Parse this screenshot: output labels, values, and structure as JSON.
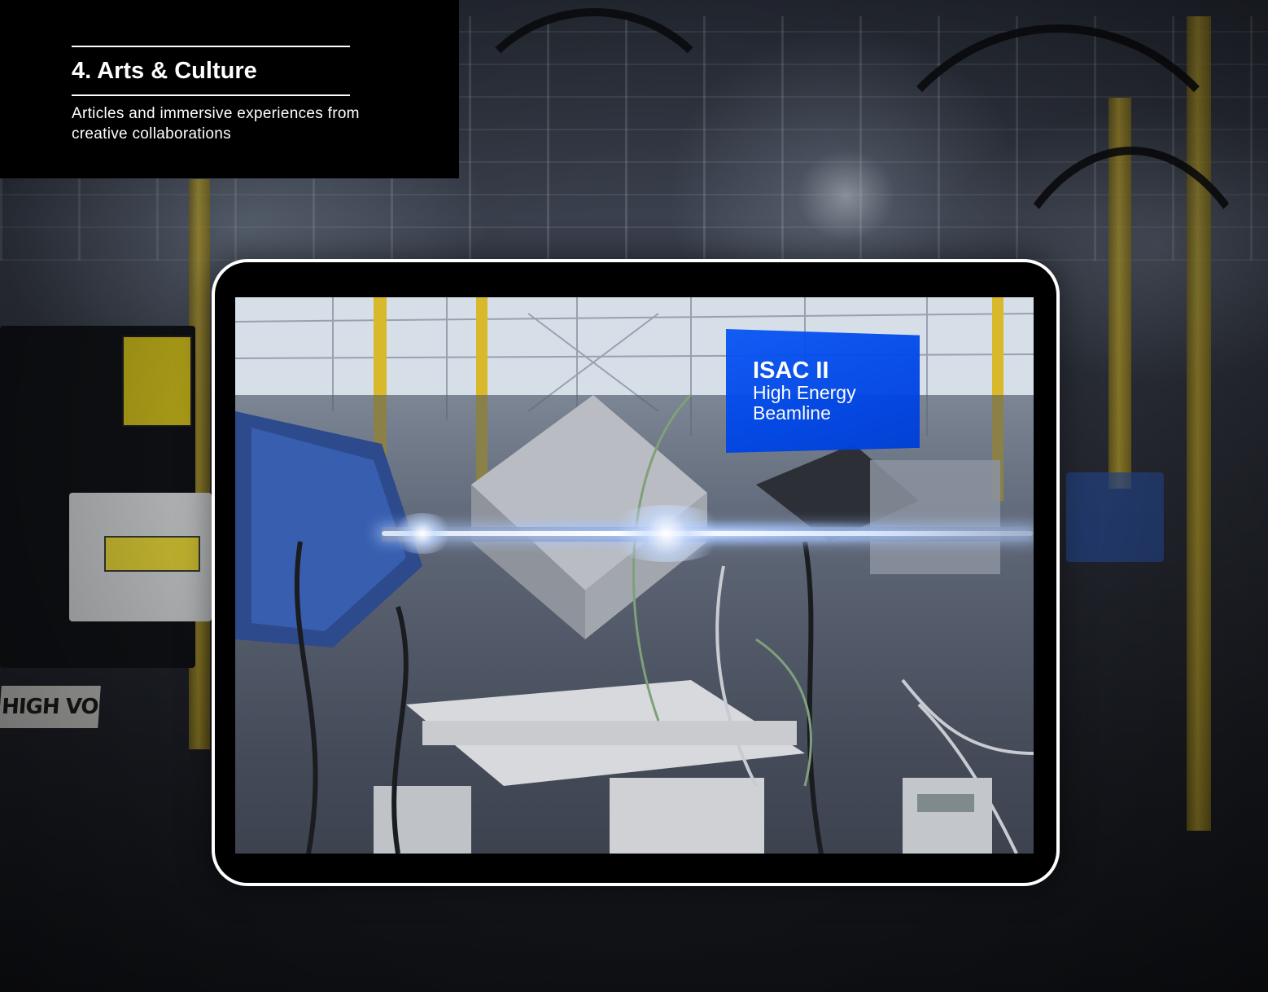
{
  "section": {
    "title": "4. Arts & Culture",
    "description": "Articles and immersive experiences from creative collaborations"
  },
  "media": {
    "label_title": "ISAC II",
    "label_subtitle": "High Energy Beamline",
    "background_sign": "HIGH VOLTAGE"
  },
  "colors": {
    "panel_background": "#000000",
    "panel_text": "#ffffff",
    "label_background": "#0046e6",
    "device_frame": "#ffffff",
    "beam_glow": "#cfe0ff"
  }
}
